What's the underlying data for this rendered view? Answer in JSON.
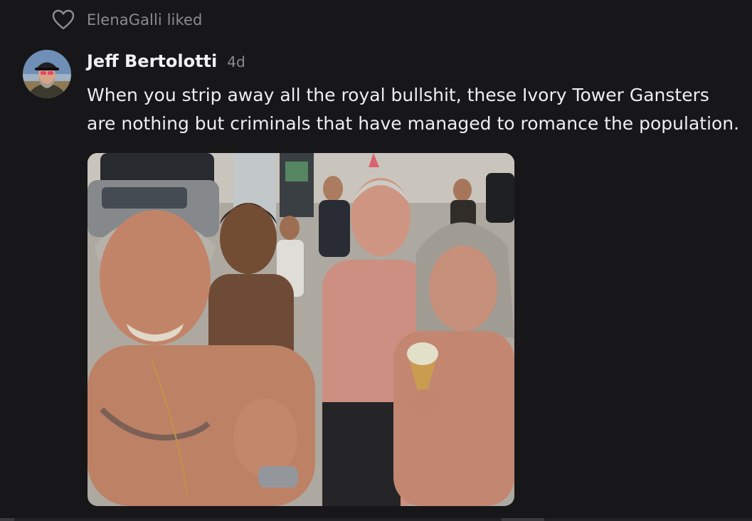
{
  "activity": {
    "liked_by": "ElenaGalli liked",
    "icon": "heart-outline-icon"
  },
  "post": {
    "author": "Jeff Bertolotti",
    "age": "4d",
    "text": "When you strip away all the royal bullshit, these Ivory Tower Gansters are nothing but criminals that have managed to romance the population.",
    "avatar_icon": "user-avatar",
    "image_icon": "post-photo"
  },
  "colors": {
    "background": "#17171a",
    "muted_text": "#8b8b90",
    "primary_text": "#eeeeee"
  }
}
